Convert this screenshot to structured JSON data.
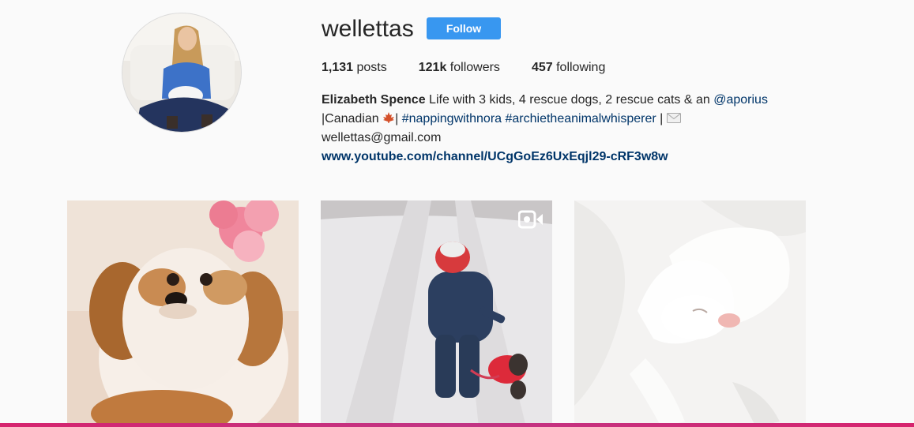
{
  "profile": {
    "username": "wellettas",
    "follow_label": "Follow",
    "avatar_alt": "wellettas's profile picture"
  },
  "stats": {
    "posts_count": "1,131",
    "posts_label": "posts",
    "followers_count": "121k",
    "followers_label": "followers",
    "following_count": "457",
    "following_label": "following"
  },
  "bio": {
    "full_name": "Elizabeth Spence",
    "text_1": " Life with 3 kids, 4 rescue dogs, 2 rescue cats & an ",
    "mention": "@aporius",
    "text_2": "|Canadian ",
    "text_3": "| ",
    "hashtag_1": "#nappingwithnora",
    "hashtag_2": "#archietheanimalwhisperer",
    "text_4": " | ",
    "email": "wellettas@gmail.com",
    "website": "www.youtube.com/channel/UCgGoEz6UxEqjl29-cRF3w8w"
  },
  "posts": [
    {
      "subject": "shih tzu puppy with pink flower",
      "type": "photo"
    },
    {
      "subject": "child in snowsuit walking dog in red coat on snowy path",
      "type": "video",
      "icon": "video-camera-icon"
    },
    {
      "subject": "white dog sleeping on white blanket",
      "type": "photo"
    }
  ],
  "colors": {
    "background": "#fafafa",
    "follow_button": "#3897f0",
    "link": "#003569",
    "text": "#262626",
    "accent_bar": "#d6246e"
  }
}
